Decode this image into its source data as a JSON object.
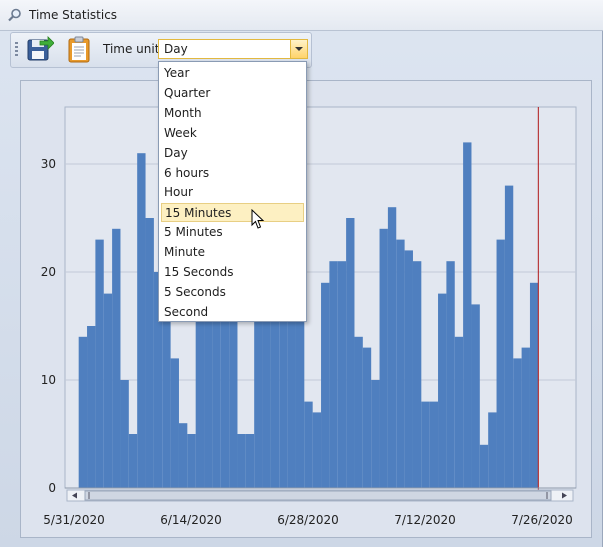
{
  "window": {
    "title": "Time Statistics"
  },
  "toolbar": {
    "time_unit_label": "Time unit",
    "time_unit_value": "Day"
  },
  "dropdown": {
    "options": [
      "Year",
      "Quarter",
      "Month",
      "Week",
      "Day",
      "6 hours",
      "Hour",
      "15 Minutes",
      "5 Minutes",
      "Minute",
      "15 Seconds",
      "5 Seconds",
      "Second"
    ],
    "highlighted_index": 7
  },
  "icons": {
    "save": "save-icon",
    "clipboard": "clipboard-icon",
    "title": "magnifier-icon"
  },
  "colors": {
    "bar": "#4f7fbf",
    "marker_line": "#b01818",
    "highlight": "#fdf0c2"
  },
  "chart_data": {
    "type": "bar",
    "x_tick_labels": [
      "5/31/2020",
      "6/14/2020",
      "6/28/2020",
      "7/12/2020",
      "7/26/2020"
    ],
    "y_tick_labels": [
      "0",
      "10",
      "20",
      "30"
    ],
    "ylim": [
      0,
      36
    ],
    "grid": true,
    "bars": [
      {
        "date": "6/1/2020",
        "value": 14
      },
      {
        "date": "6/2/2020",
        "value": 15
      },
      {
        "date": "6/3/2020",
        "value": 23
      },
      {
        "date": "6/4/2020",
        "value": 18
      },
      {
        "date": "6/5/2020",
        "value": 24
      },
      {
        "date": "6/6/2020",
        "value": 10
      },
      {
        "date": "6/7/2020",
        "value": 5
      },
      {
        "date": "6/8/2020",
        "value": 31
      },
      {
        "date": "6/9/2020",
        "value": 25
      },
      {
        "date": "6/10/2020",
        "value": 20
      },
      {
        "date": "6/11/2020",
        "value": 19
      },
      {
        "date": "6/12/2020",
        "value": 12
      },
      {
        "date": "6/13/2020",
        "value": 6
      },
      {
        "date": "6/14/2020",
        "value": 5
      },
      {
        "date": "6/15/2020",
        "value": 22
      },
      {
        "date": "6/16/2020",
        "value": 26
      },
      {
        "date": "6/17/2020",
        "value": 24
      },
      {
        "date": "6/18/2020",
        "value": 23
      },
      {
        "date": "6/19/2020",
        "value": 20
      },
      {
        "date": "6/20/2020",
        "value": 5
      },
      {
        "date": "6/21/2020",
        "value": 5
      },
      {
        "date": "6/22/2020",
        "value": 18
      },
      {
        "date": "6/23/2020",
        "value": 20
      },
      {
        "date": "6/24/2020",
        "value": 22
      },
      {
        "date": "6/25/2020",
        "value": 21
      },
      {
        "date": "6/26/2020",
        "value": 19
      },
      {
        "date": "6/27/2020",
        "value": 16
      },
      {
        "date": "6/28/2020",
        "value": 8
      },
      {
        "date": "6/29/2020",
        "value": 7
      },
      {
        "date": "6/30/2020",
        "value": 19
      },
      {
        "date": "7/1/2020",
        "value": 21
      },
      {
        "date": "7/2/2020",
        "value": 21
      },
      {
        "date": "7/3/2020",
        "value": 25
      },
      {
        "date": "7/4/2020",
        "value": 14
      },
      {
        "date": "7/5/2020",
        "value": 13
      },
      {
        "date": "7/6/2020",
        "value": 10
      },
      {
        "date": "7/7/2020",
        "value": 24
      },
      {
        "date": "7/8/2020",
        "value": 26
      },
      {
        "date": "7/9/2020",
        "value": 23
      },
      {
        "date": "7/10/2020",
        "value": 22
      },
      {
        "date": "7/11/2020",
        "value": 21
      },
      {
        "date": "7/12/2020",
        "value": 8
      },
      {
        "date": "7/13/2020",
        "value": 8
      },
      {
        "date": "7/14/2020",
        "value": 18
      },
      {
        "date": "7/15/2020",
        "value": 21
      },
      {
        "date": "7/16/2020",
        "value": 14
      },
      {
        "date": "7/17/2020",
        "value": 32
      },
      {
        "date": "7/18/2020",
        "value": 17
      },
      {
        "date": "7/19/2020",
        "value": 4
      },
      {
        "date": "7/20/2020",
        "value": 7
      },
      {
        "date": "7/21/2020",
        "value": 23
      },
      {
        "date": "7/22/2020",
        "value": 28
      },
      {
        "date": "7/23/2020",
        "value": 12
      },
      {
        "date": "7/24/2020",
        "value": 13
      },
      {
        "date": "7/25/2020",
        "value": 19
      }
    ],
    "marker_line_date": "7/26/2020"
  }
}
